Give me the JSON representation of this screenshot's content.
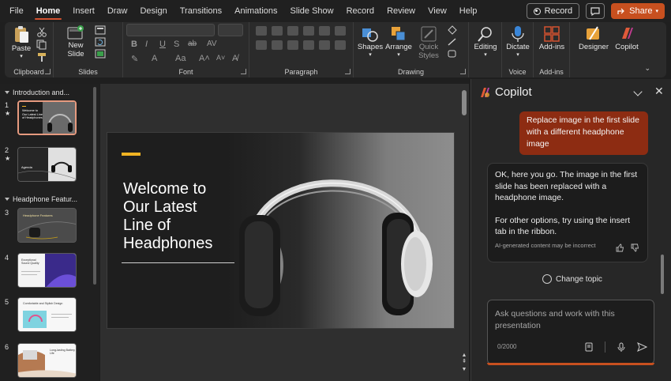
{
  "menu": {
    "tabs": [
      "File",
      "Home",
      "Insert",
      "Draw",
      "Design",
      "Transitions",
      "Animations",
      "Slide Show",
      "Record",
      "Review",
      "View",
      "Help"
    ],
    "active_tab": "Home",
    "record_label": "Record",
    "share_label": "Share"
  },
  "ribbon": {
    "clipboard": {
      "paste_label": "Paste",
      "group_label": "Clipboard"
    },
    "slides": {
      "new_slide_label": "New\nSlide",
      "group_label": "Slides"
    },
    "font": {
      "group_label": "Font",
      "bold": "B",
      "italic": "I",
      "underline": "U",
      "strike": "S",
      "clear_format": "ab",
      "char_spacing": "AV"
    },
    "paragraph": {
      "group_label": "Paragraph"
    },
    "drawing": {
      "shapes_label": "Shapes",
      "arrange_label": "Arrange",
      "quick_styles_label": "Quick\nStyles",
      "group_label": "Drawing"
    },
    "editing": {
      "label": "Editing"
    },
    "voice": {
      "dictate_label": "Dictate",
      "group_label": "Voice"
    },
    "addins": {
      "label": "Add-ins",
      "group_label": "Add-ins"
    },
    "designer_label": "Designer",
    "copilot_label": "Copilot"
  },
  "thumbnails": {
    "sections": [
      {
        "title": "Introduction and..."
      },
      {
        "title": "Headphone Featur..."
      }
    ],
    "slides": [
      {
        "num": "1",
        "star": "★",
        "caption": "Welcome to Our Latest Line of Headphones"
      },
      {
        "num": "2",
        "star": "★",
        "caption": "Agenda"
      },
      {
        "num": "3",
        "star": "",
        "caption": "Headphone Features"
      },
      {
        "num": "4",
        "star": "",
        "caption": "Exceptional Sound Quality"
      },
      {
        "num": "5",
        "star": "",
        "caption": "Comfortable and Stylish Design"
      },
      {
        "num": "6",
        "star": "",
        "caption": "Long-lasting Battery Life"
      }
    ]
  },
  "slide": {
    "title": "Welcome to\nOur Latest\nLine of\nHeadphones",
    "accent_color": "#f0b323"
  },
  "copilot": {
    "title": "Copilot",
    "user_message": "Replace image in the first slide with a different headphone image",
    "ai_message_1": "OK, here you go. The image in the first slide has been replaced with a headphone image.",
    "ai_message_2": "For other options, try using the insert tab in the ribbon.",
    "disclaimer": "AI-generated content may be incorrect",
    "change_topic": "Change topic",
    "input_placeholder": "Ask questions and work with this presentation",
    "counter": "0/2000",
    "brand_color": "#c8501f"
  }
}
